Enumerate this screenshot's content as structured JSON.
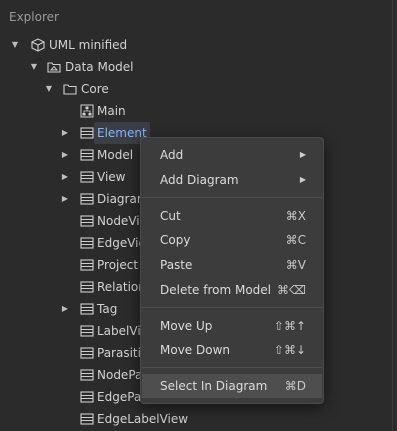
{
  "panel": {
    "title": "Explorer"
  },
  "tree": [
    {
      "label": "UML minified",
      "icon": "uml-cube-icon",
      "arrow": "▼",
      "selected": false
    },
    {
      "label": "Data Model",
      "icon": "model-folder-icon",
      "arrow": "▼",
      "selected": false
    },
    {
      "label": "Core",
      "icon": "folder-icon",
      "arrow": "▼",
      "selected": false
    },
    {
      "label": "Main",
      "icon": "diagram-icon",
      "arrow": "",
      "selected": false
    },
    {
      "label": "Element",
      "icon": "class-icon",
      "arrow": "▶",
      "selected": true
    },
    {
      "label": "Model",
      "icon": "class-icon",
      "arrow": "▶",
      "selected": false
    },
    {
      "label": "View",
      "icon": "class-icon",
      "arrow": "▶",
      "selected": false
    },
    {
      "label": "Diagram",
      "icon": "class-icon",
      "arrow": "▶",
      "selected": false
    },
    {
      "label": "NodeView",
      "icon": "class-icon",
      "arrow": "",
      "selected": false
    },
    {
      "label": "EdgeView",
      "icon": "class-icon",
      "arrow": "",
      "selected": false
    },
    {
      "label": "Project",
      "icon": "class-icon",
      "arrow": "",
      "selected": false
    },
    {
      "label": "Relationship",
      "icon": "class-icon",
      "arrow": "",
      "selected": false
    },
    {
      "label": "Tag",
      "icon": "class-icon",
      "arrow": "▶",
      "selected": false
    },
    {
      "label": "LabelView",
      "icon": "class-icon",
      "arrow": "",
      "selected": false
    },
    {
      "label": "ParasiticView",
      "icon": "class-icon",
      "arrow": "",
      "selected": false
    },
    {
      "label": "NodeParasiticView",
      "icon": "class-icon",
      "arrow": "",
      "selected": false
    },
    {
      "label": "EdgeParasiticView",
      "icon": "class-icon",
      "arrow": "",
      "selected": false
    },
    {
      "label": "EdgeLabelView",
      "icon": "class-icon",
      "arrow": "",
      "selected": false
    }
  ],
  "context_menu": {
    "items": [
      {
        "label": "Add",
        "shortcut": "",
        "submenu": true
      },
      {
        "label": "Add Diagram",
        "shortcut": "",
        "submenu": true
      },
      {
        "label": "Cut",
        "shortcut": "⌘X",
        "submenu": false
      },
      {
        "label": "Copy",
        "shortcut": "⌘C",
        "submenu": false
      },
      {
        "label": "Paste",
        "shortcut": "⌘V",
        "submenu": false
      },
      {
        "label": "Delete from Model",
        "shortcut": "⌘⌫",
        "submenu": false
      },
      {
        "label": "Move Up",
        "shortcut": "⇧⌘↑",
        "submenu": false
      },
      {
        "label": "Move Down",
        "shortcut": "⇧⌘↓",
        "submenu": false
      },
      {
        "label": "Select In Diagram",
        "shortcut": "⌘D",
        "submenu": false
      }
    ],
    "submenu_arrow": "▶"
  },
  "colors": {
    "background": "#2b2b2b",
    "menu_background": "#3c3c3c",
    "menu_highlight": "#4e4e4e",
    "selected_text": "#7fb7ff"
  }
}
